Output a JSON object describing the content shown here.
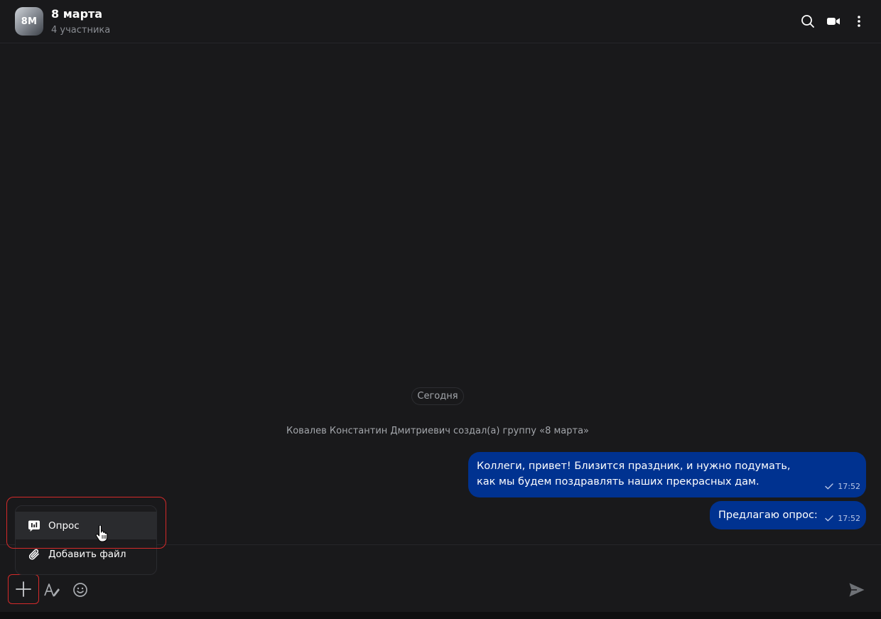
{
  "header": {
    "avatar_text": "8M",
    "title": "8 марта",
    "subtitle": "4 участника",
    "icons": [
      "search-icon",
      "video-call-icon",
      "more-vertical-icon"
    ]
  },
  "feed": {
    "date_label": "Сегодня",
    "system_message": "Ковалев Константин Дмитриевич создал(а) группу «8 марта»",
    "messages": [
      {
        "text": "Коллеги, привет! Близится праздник, и нужно подумать, как мы будем поздравлять наших прекрасных дам.",
        "time": "17:52",
        "status": "sent"
      },
      {
        "text": "Предлагаю опрос:",
        "time": "17:52",
        "status": "sent"
      }
    ]
  },
  "attach_menu": {
    "items": [
      {
        "label": "Опрос",
        "icon": "poll-icon"
      },
      {
        "label": "Добавить файл",
        "icon": "paperclip-icon"
      }
    ]
  },
  "composer": {
    "icons": [
      "plus-icon",
      "text-format-icon",
      "emoji-icon",
      "send-icon"
    ]
  },
  "colors": {
    "background": "#19191b",
    "bubble": "#003290",
    "highlight": "#d42a2a"
  }
}
